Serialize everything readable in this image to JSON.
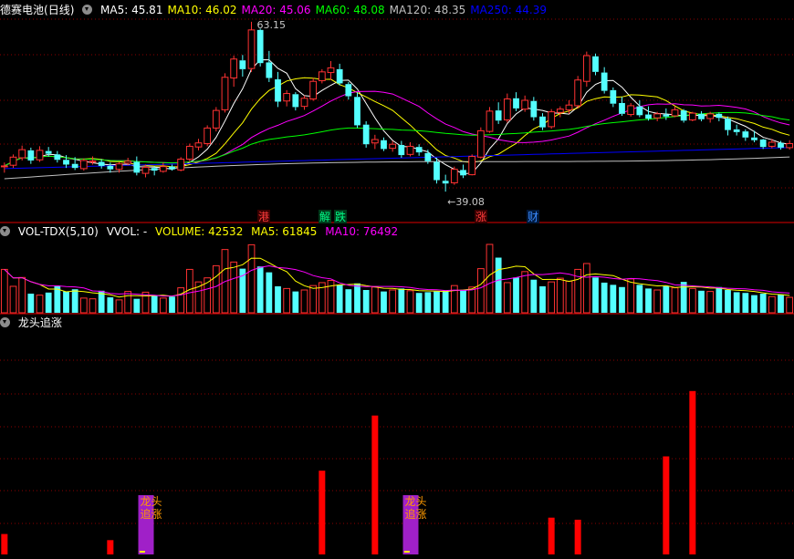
{
  "price_header": {
    "stock": "德赛电池",
    "period": "(日线)",
    "ma": [
      {
        "label": "MA5: 45.81",
        "color": "#ffffff"
      },
      {
        "label": "MA10: 46.02",
        "color": "#ffff00"
      },
      {
        "label": "MA20: 45.06",
        "color": "#ff00ff"
      },
      {
        "label": "MA60: 48.08",
        "color": "#00ff00"
      },
      {
        "label": "MA120: 48.35",
        "color": "#c0c0c0"
      },
      {
        "label": "MA250: 44.39",
        "color": "#0000ff"
      }
    ]
  },
  "price_annotations": {
    "high": "63.15",
    "low": "←39.08"
  },
  "event_markers": [
    {
      "label": "港",
      "color": "#ff3b3b",
      "bg": "#3a0000"
    },
    {
      "label": "解",
      "color": "#00ff88",
      "bg": "#003a1a"
    },
    {
      "label": "跌",
      "color": "#00ff88",
      "bg": "#003a1a"
    },
    {
      "label": "涨",
      "color": "#ff3b3b",
      "bg": "#3a0000"
    },
    {
      "label": "财",
      "color": "#3b8bff",
      "bg": "#00183a"
    }
  ],
  "volume_header": {
    "name": "VOL-TDX(5,10)",
    "vvol": "VVOL: -",
    "volume": "VOLUME: 42532",
    "ma5": "MA5: 61845",
    "ma10": "MA10: 76492"
  },
  "indicator_header": {
    "name": "龙头追涨"
  },
  "indicator_labels": [
    "龙头",
    "追涨"
  ],
  "colors": {
    "up": "#ff3232",
    "down": "#54ffff",
    "grid": "#8b0000",
    "ma5": "#ffffff",
    "ma10": "#ffff00",
    "ma20": "#ff00ff",
    "ma60": "#00ff00",
    "ma120": "#c0c0c0",
    "ma250": "#0000ff",
    "signal": "#ff0000",
    "dragon": "#a020c8"
  },
  "chart_data": {
    "type": "candlestick",
    "price_range": [
      37.5,
      65
    ],
    "ohlc": [
      [
        42.8,
        43.4,
        41.9,
        42.9
      ],
      [
        43.0,
        44.6,
        42.6,
        44.2
      ],
      [
        44.1,
        45.9,
        43.7,
        45.3
      ],
      [
        45.2,
        45.6,
        43.2,
        43.7
      ],
      [
        43.8,
        45.8,
        43.5,
        45.2
      ],
      [
        45.1,
        45.7,
        44.3,
        44.7
      ],
      [
        44.6,
        45.1,
        43.4,
        43.8
      ],
      [
        43.8,
        44.5,
        42.6,
        43.1
      ],
      [
        43.2,
        44.2,
        42.3,
        42.6
      ],
      [
        42.5,
        44.0,
        42.2,
        43.7
      ],
      [
        43.6,
        44.3,
        43.1,
        43.6
      ],
      [
        43.5,
        43.9,
        42.5,
        42.9
      ],
      [
        42.9,
        43.4,
        41.9,
        42.4
      ],
      [
        42.4,
        43.5,
        41.9,
        43.2
      ],
      [
        43.3,
        44.1,
        43.0,
        43.6
      ],
      [
        43.5,
        44.3,
        41.5,
        41.9
      ],
      [
        41.8,
        43.1,
        41.2,
        42.7
      ],
      [
        42.6,
        42.9,
        41.5,
        42.2
      ],
      [
        42.1,
        43.4,
        41.9,
        42.8
      ],
      [
        42.8,
        43.1,
        42.2,
        42.4
      ],
      [
        42.3,
        44.2,
        42.1,
        43.9
      ],
      [
        43.9,
        46.2,
        43.5,
        45.8
      ],
      [
        45.7,
        46.9,
        45.2,
        46.3
      ],
      [
        46.2,
        48.9,
        45.8,
        48.5
      ],
      [
        48.5,
        51.6,
        48.0,
        51.1
      ],
      [
        51.2,
        56.6,
        50.8,
        56.0
      ],
      [
        55.9,
        59.2,
        54.6,
        58.7
      ],
      [
        58.5,
        59.3,
        56.1,
        57.2
      ],
      [
        57.3,
        64.2,
        56.8,
        63.0
      ],
      [
        63.0,
        63.2,
        57.6,
        58.1
      ],
      [
        58.2,
        59.9,
        55.3,
        55.9
      ],
      [
        55.7,
        56.8,
        51.6,
        52.4
      ],
      [
        52.5,
        54.1,
        51.7,
        53.6
      ],
      [
        53.5,
        53.8,
        51.1,
        51.6
      ],
      [
        51.7,
        53.3,
        51.2,
        52.9
      ],
      [
        52.8,
        55.9,
        52.5,
        55.4
      ],
      [
        55.5,
        57.2,
        55.1,
        56.8
      ],
      [
        56.7,
        58.4,
        55.6,
        57.4
      ],
      [
        57.2,
        58.0,
        54.8,
        55.1
      ],
      [
        55.0,
        55.3,
        52.7,
        53.2
      ],
      [
        53.1,
        53.8,
        48.5,
        48.9
      ],
      [
        49.0,
        49.5,
        45.6,
        46.1
      ],
      [
        46.3,
        47.5,
        45.4,
        46.8
      ],
      [
        46.7,
        47.1,
        45.1,
        45.4
      ],
      [
        45.5,
        46.6,
        45.0,
        46.1
      ],
      [
        46.0,
        46.6,
        44.1,
        44.5
      ],
      [
        44.6,
        46.4,
        44.3,
        45.8
      ],
      [
        45.7,
        46.1,
        44.4,
        44.9
      ],
      [
        44.8,
        45.3,
        43.2,
        43.6
      ],
      [
        43.5,
        44.1,
        40.3,
        40.8
      ],
      [
        40.7,
        41.6,
        39.1,
        40.3
      ],
      [
        40.4,
        42.8,
        40.1,
        42.4
      ],
      [
        42.3,
        43.1,
        41.1,
        41.5
      ],
      [
        41.6,
        44.6,
        41.5,
        44.3
      ],
      [
        44.2,
        48.6,
        44.0,
        48.1
      ],
      [
        48.0,
        51.6,
        47.8,
        51.0
      ],
      [
        51.1,
        52.3,
        49.1,
        49.6
      ],
      [
        49.7,
        53.6,
        49.3,
        52.8
      ],
      [
        52.9,
        53.8,
        51.0,
        51.4
      ],
      [
        51.3,
        53.3,
        50.9,
        52.6
      ],
      [
        52.5,
        53.1,
        49.6,
        50.1
      ],
      [
        50.2,
        50.7,
        48.2,
        48.6
      ],
      [
        48.7,
        51.3,
        48.4,
        50.9
      ],
      [
        50.8,
        51.7,
        50.1,
        51.3
      ],
      [
        51.2,
        52.6,
        50.6,
        51.9
      ],
      [
        51.8,
        56.2,
        51.4,
        55.6
      ],
      [
        55.4,
        59.8,
        54.6,
        59.2
      ],
      [
        59.1,
        59.5,
        56.3,
        56.8
      ],
      [
        56.7,
        57.5,
        53.6,
        54.0
      ],
      [
        54.1,
        54.5,
        51.6,
        52.1
      ],
      [
        52.2,
        53.1,
        50.3,
        50.6
      ],
      [
        50.5,
        52.2,
        50.2,
        51.8
      ],
      [
        51.7,
        52.6,
        50.1,
        50.4
      ],
      [
        50.5,
        51.7,
        49.6,
        49.9
      ],
      [
        50.0,
        50.9,
        49.5,
        50.6
      ],
      [
        50.5,
        51.4,
        49.7,
        50.2
      ],
      [
        50.3,
        51.7,
        50.1,
        51.2
      ],
      [
        51.1,
        51.3,
        49.3,
        49.6
      ],
      [
        49.7,
        50.9,
        49.5,
        50.7
      ],
      [
        50.6,
        51.0,
        49.5,
        49.8
      ],
      [
        49.9,
        50.9,
        49.3,
        50.6
      ],
      [
        50.6,
        50.8,
        49.5,
        50.0
      ],
      [
        49.9,
        50.2,
        47.4,
        48.2
      ],
      [
        48.3,
        49.0,
        47.4,
        47.9
      ],
      [
        48.0,
        48.3,
        46.6,
        47.1
      ],
      [
        47.1,
        48.1,
        46.4,
        46.7
      ],
      [
        46.8,
        46.9,
        45.4,
        45.7
      ],
      [
        45.8,
        46.9,
        45.5,
        46.4
      ],
      [
        46.3,
        46.6,
        45.3,
        45.6
      ],
      [
        45.6,
        46.7,
        45.3,
        46.2
      ]
    ],
    "volume": [
      118,
      72,
      96,
      52,
      48,
      55,
      72,
      58,
      64,
      40,
      38,
      60,
      42,
      35,
      58,
      38,
      56,
      46,
      40,
      44,
      68,
      118,
      84,
      95,
      128,
      172,
      138,
      120,
      185,
      126,
      110,
      72,
      66,
      58,
      62,
      74,
      82,
      88,
      76,
      64,
      80,
      62,
      70,
      58,
      62,
      66,
      60,
      54,
      56,
      58,
      60,
      74,
      62,
      70,
      120,
      186,
      150,
      82,
      96,
      112,
      90,
      72,
      84,
      94,
      86,
      118,
      134,
      96,
      82,
      76,
      70,
      92,
      76,
      66,
      62,
      72,
      68,
      84,
      66,
      60,
      58,
      70,
      62,
      56,
      54,
      48,
      52,
      44,
      50,
      42
    ],
    "signal": [
      20,
      0,
      0,
      0,
      0,
      0,
      0,
      0,
      0,
      0,
      0,
      0,
      14,
      0,
      0,
      0,
      0,
      0,
      0,
      0,
      0,
      0,
      0,
      0,
      0,
      0,
      0,
      0,
      0,
      0,
      0,
      0,
      0,
      0,
      0,
      0,
      0,
      0,
      0,
      0,
      0,
      0,
      0,
      0,
      0,
      0,
      0,
      0,
      0,
      0,
      0,
      0,
      0,
      0,
      0,
      0,
      0,
      0,
      0,
      0,
      0,
      0,
      0,
      0,
      0,
      0,
      0,
      0,
      0,
      0,
      0,
      0,
      0,
      0,
      0,
      0,
      0,
      0,
      0,
      0,
      0,
      0,
      0,
      0,
      0,
      0,
      0,
      0,
      0,
      0
    ],
    "signal_bars": [
      {
        "index": 0,
        "value": 20
      },
      {
        "index": 12,
        "value": 14
      },
      {
        "index": 36,
        "value": 82
      },
      {
        "index": 42,
        "value": 136
      },
      {
        "index": 62,
        "value": 36
      },
      {
        "index": 65,
        "value": 34
      },
      {
        "index": 75,
        "value": 96
      },
      {
        "index": 78,
        "value": 160
      }
    ],
    "dragon_bars": [
      16,
      46
    ]
  }
}
